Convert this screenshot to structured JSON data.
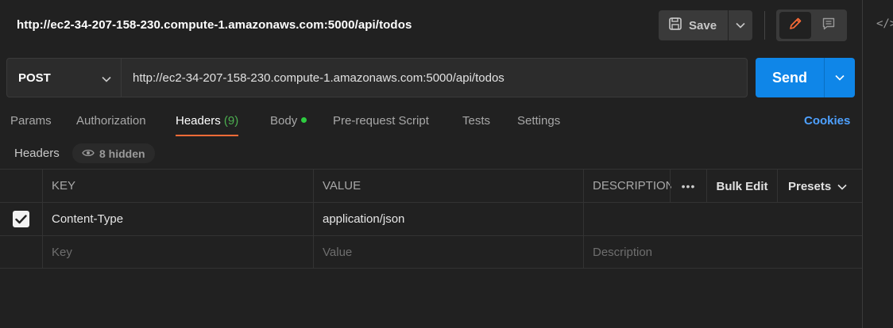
{
  "request": {
    "title": "http://ec2-34-207-158-230.compute-1.amazonaws.com:5000/api/todos",
    "method": "POST",
    "url": "http://ec2-34-207-158-230.compute-1.amazonaws.com:5000/api/todos"
  },
  "toolbar": {
    "save_label": "Save",
    "send_label": "Send"
  },
  "tabs": {
    "params": "Params",
    "authorization": "Authorization",
    "headers": "Headers",
    "headers_count": "(9)",
    "body": "Body",
    "prerequest": "Pre-request Script",
    "tests": "Tests",
    "settings": "Settings",
    "cookies": "Cookies"
  },
  "headers_section": {
    "label": "Headers",
    "hidden_label": "8 hidden"
  },
  "table": {
    "columns": {
      "key": "KEY",
      "value": "VALUE",
      "description": "DESCRIPTION"
    },
    "more_label": "•••",
    "bulk_edit_label": "Bulk Edit",
    "presets_label": "Presets",
    "rows": [
      {
        "checked": true,
        "key": "Content-Type",
        "value": "application/json",
        "description": ""
      }
    ],
    "placeholders": {
      "key": "Key",
      "value": "Value",
      "description": "Description"
    }
  },
  "colors": {
    "accent_send": "#0f86e8",
    "active_tab_underline": "#ff6c37",
    "cookies_link": "#4ea1ff",
    "body_dot": "#2ecc40",
    "header_count": "#4caf50"
  },
  "icons": {
    "save": "save-icon",
    "edit": "pencil-icon",
    "comment": "comment-icon",
    "code": "code-icon",
    "eye": "eye-icon",
    "chevron": "chevron-down-icon"
  }
}
